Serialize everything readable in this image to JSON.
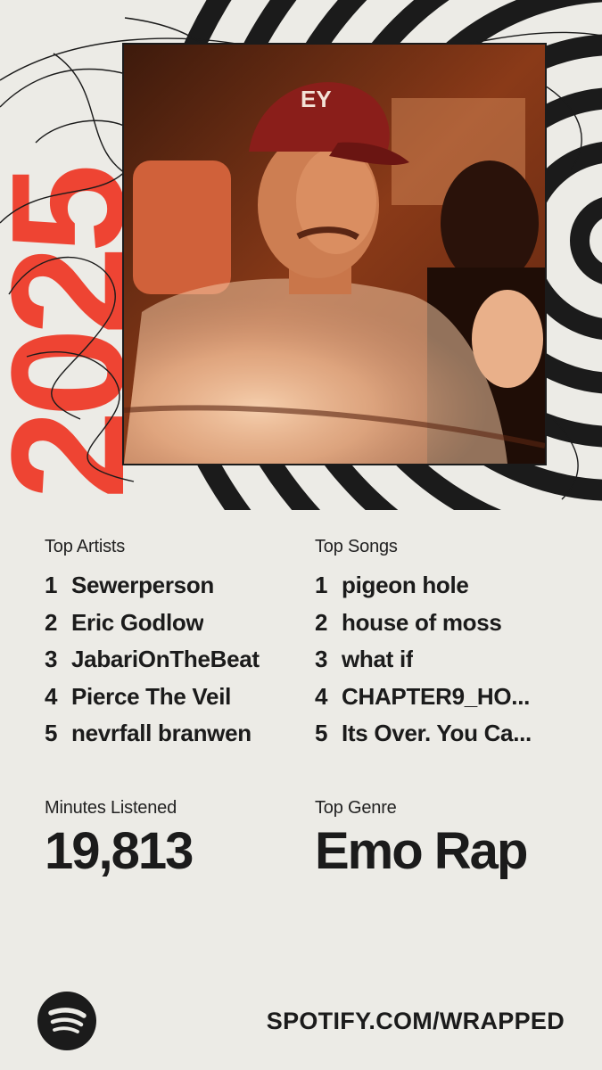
{
  "hero": {
    "year_graphic": "2025",
    "photo_alt": "Artist portrait in car wearing red EY cap",
    "cap_logo_text": "EY"
  },
  "top_artists": {
    "label": "Top Artists",
    "items": [
      {
        "rank": "1",
        "name": "Sewerperson"
      },
      {
        "rank": "2",
        "name": "Eric Godlow"
      },
      {
        "rank": "3",
        "name": "JabariOnTheBeat"
      },
      {
        "rank": "4",
        "name": "Pierce The Veil"
      },
      {
        "rank": "5",
        "name": "nevrfall branwen"
      }
    ]
  },
  "top_songs": {
    "label": "Top Songs",
    "items": [
      {
        "rank": "1",
        "name": "pigeon hole"
      },
      {
        "rank": "2",
        "name": "house of moss"
      },
      {
        "rank": "3",
        "name": "what if"
      },
      {
        "rank": "4",
        "name": "CHAPTER9_HO..."
      },
      {
        "rank": "5",
        "name": "Its Over. You Ca..."
      }
    ]
  },
  "minutes": {
    "label": "Minutes Listened",
    "value": "19,813"
  },
  "genre": {
    "label": "Top Genre",
    "value": "Emo Rap"
  },
  "footer": {
    "url": "SPOTIFY.COM/WRAPPED",
    "logo_icon": "spotify-logo-icon"
  },
  "colors": {
    "accent_red": "#ee4433",
    "background": "#ecebe6",
    "ink": "#1b1b1b"
  }
}
